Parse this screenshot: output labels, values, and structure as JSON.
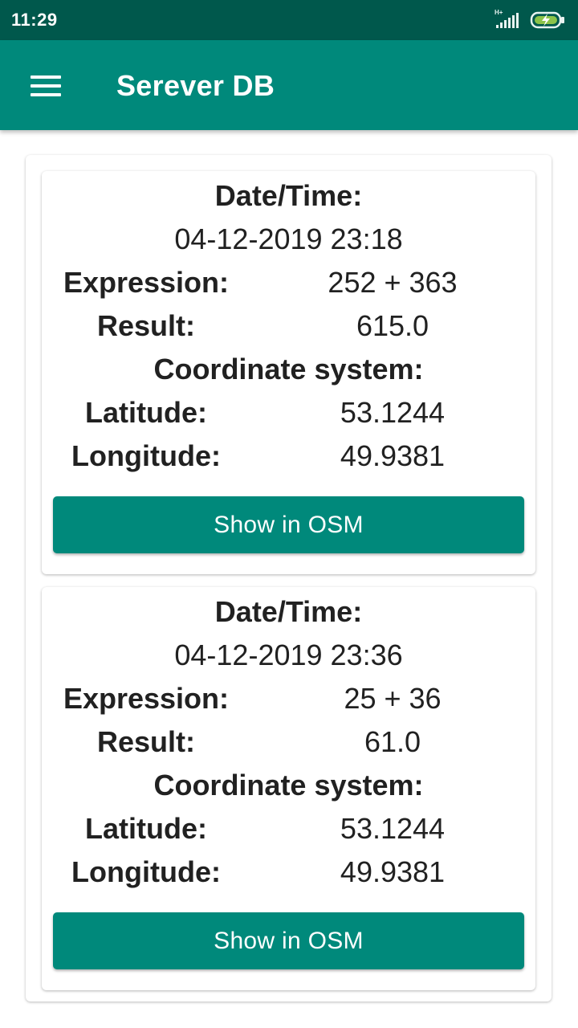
{
  "status_bar": {
    "time": "11:29",
    "network_type": "H+",
    "icons": [
      "signal-icon",
      "battery-charging-icon"
    ]
  },
  "app_bar": {
    "title": "Serever DB",
    "menu_icon": "hamburger-menu-icon"
  },
  "records": [
    {
      "datetime_label": "Date/Time:",
      "datetime": "04-12-2019 23:18",
      "expression_label": "Expression:",
      "expression": "252 + 363",
      "result_label": "Result:",
      "result": "615.0",
      "coord_label": "Coordinate system:",
      "latitude_label": "Latitude:",
      "latitude": "53.1244",
      "longitude_label": "Longitude:",
      "longitude": "49.9381",
      "button_label": "Show in OSM"
    },
    {
      "datetime_label": "Date/Time:",
      "datetime": "04-12-2019 23:36",
      "expression_label": "Expression:",
      "expression": "25 + 36",
      "result_label": "Result:",
      "result": "61.0",
      "coord_label": "Coordinate system:",
      "latitude_label": "Latitude:",
      "latitude": "53.1244",
      "longitude_label": "Longitude:",
      "longitude": "49.9381",
      "button_label": "Show in OSM"
    }
  ],
  "colors": {
    "status_bar": "#00584c",
    "primary": "#00897b",
    "text": "#212121",
    "battery_charge": "#8bc34a"
  }
}
